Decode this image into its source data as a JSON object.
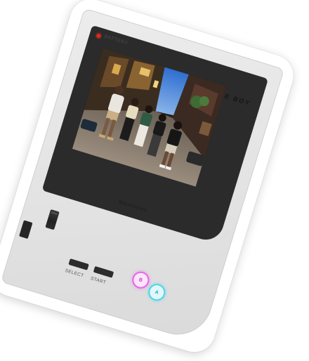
{
  "device": {
    "battery_label": "BATTERY",
    "brand_label": "GAME BOY",
    "model_label": "Memories",
    "select_label": "SELECT",
    "start_label": "START",
    "b_label": "B",
    "a_label": "A",
    "led_color": "#e0261b",
    "b_color": "#e668e8",
    "a_color": "#4ed5e8"
  },
  "screen": {
    "photo_description_icon": "group-photo-city-street-dusk"
  }
}
